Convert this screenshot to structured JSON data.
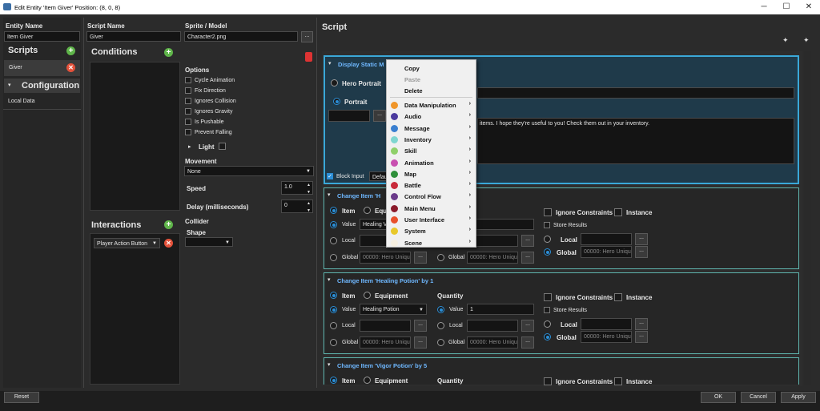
{
  "window": {
    "title": "Edit Entity 'Item Giver' Position: (8, 0, 8)",
    "min": "─",
    "max": "☐",
    "close": "✕"
  },
  "entity": {
    "name_label": "Entity Name",
    "name_value": "Item Giver"
  },
  "left": {
    "scripts_label": "Scripts",
    "script_item": "Giver",
    "configuration_label": "Configuration",
    "config_item": "Local Data"
  },
  "script_name": {
    "label": "Script Name",
    "value": "Giver"
  },
  "sprite": {
    "label": "Sprite / Model",
    "value": "Character2.png",
    "browse": "..."
  },
  "conditions": {
    "label": "Conditions"
  },
  "options": {
    "label": "Options",
    "items": [
      "Cycle Animation",
      "Fix Direction",
      "Ignores Collision",
      "Ignores Gravity",
      "Is Pushable",
      "Prevent Falling"
    ],
    "light": "Light"
  },
  "movement": {
    "label": "Movement",
    "value": "None",
    "speed_label": "Speed",
    "speed_value": "1.0",
    "delay_label": "Delay (milliseconds)",
    "delay_value": "0"
  },
  "interactions": {
    "label": "Interactions",
    "item": "Player Action Button"
  },
  "collider": {
    "label": "Collider",
    "shape_label": "Shape",
    "shape_value": ""
  },
  "script": {
    "label": "Script"
  },
  "msg": {
    "title": "Display Static M",
    "hero_portrait": "Hero Portrait",
    "portrait": "Portrait",
    "text": "items.  I hope they're useful to you!  Check them out in your inventory.",
    "block_input": "Block Input",
    "default": "Defau"
  },
  "ci1": {
    "title": "Change Item 'H",
    "item": "Item",
    "equ": "Equ",
    "value_label": "Value",
    "value": "Healing V",
    "local": "Local",
    "global": "Global",
    "global_ph": "00000: Hero Uniqu",
    "ignore": "Ignore Constraints",
    "instance": "Instance",
    "store": "Store Results",
    "local2": "Local",
    "global2": "Global",
    "global2_ph": "00000: Hero Uniqu"
  },
  "ci2": {
    "title": "Change Item 'Healing Potion' by 1",
    "item": "Item",
    "equipment": "Equipment",
    "value_label": "Value",
    "value": "Healing Potion",
    "local": "Local",
    "global": "Global",
    "global_ph": "00000: Hero Uniqu",
    "quantity": "Quantity",
    "qvalue_label": "Value",
    "qvalue": "1",
    "qlocal": "Local",
    "qglobal": "Global",
    "qglobal_ph": "00000: Hero Uniqu",
    "ignore": "Ignore Constraints",
    "instance": "Instance",
    "store": "Store Results",
    "local2": "Local",
    "global2": "Global",
    "global2_ph": "00000: Hero Uniqu"
  },
  "ci3": {
    "title": "Change Item 'Vigor Potion' by 5",
    "item": "Item",
    "equipment": "Equipment",
    "quantity": "Quantity",
    "ignore": "Ignore Constraints",
    "instance": "Instance"
  },
  "menu": {
    "copy": "Copy",
    "paste": "Paste",
    "delete": "Delete",
    "items": [
      {
        "label": "Data Manipulation",
        "color": "#f0962a"
      },
      {
        "label": "Audio",
        "color": "#4b3a9e"
      },
      {
        "label": "Message",
        "color": "#3a7fd0"
      },
      {
        "label": "Inventory",
        "color": "#7fd6d0"
      },
      {
        "label": "Skill",
        "color": "#8fd06a"
      },
      {
        "label": "Animation",
        "color": "#c84fb0"
      },
      {
        "label": "Map",
        "color": "#2f8f3a"
      },
      {
        "label": "Battle",
        "color": "#c82a3a"
      },
      {
        "label": "Control Flow",
        "color": "#6a3a8a"
      },
      {
        "label": "Main Menu",
        "color": "#8a1a2a"
      },
      {
        "label": "User Interface",
        "color": "#e8502a"
      },
      {
        "label": "System",
        "color": "#e8c82a"
      },
      {
        "label": "Scene",
        "color": "#f5efe0"
      }
    ]
  },
  "buttons": {
    "reset": "Reset",
    "ok": "OK",
    "cancel": "Cancel",
    "apply": "Apply",
    "browse": "..."
  }
}
